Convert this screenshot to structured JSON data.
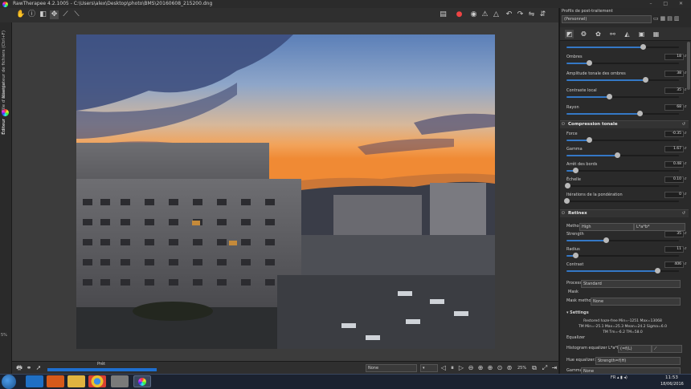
{
  "window": {
    "title": "RawTherapee 4.2.1005 - C:\\Users\\alex\\Desktop\\photo\\BMS\\20160608_215200.dng",
    "controls": [
      "–",
      "□",
      "✕"
    ]
  },
  "icons": {
    "toolbar": [
      "hand-icon",
      "info-icon",
      "crop-select-icon",
      "pan-icon",
      "color-picker-icon",
      "straighten-icon"
    ],
    "toolbar_right": [
      "compare-icon",
      "color-channels-icon",
      "focus-mask-icon",
      "warning-shadow-icon",
      "warning-highlight-icon",
      "rotate-left-icon",
      "rotate-right-icon",
      "flip-horizontal-icon",
      "flip-vertical-icon"
    ]
  },
  "left_tabs": {
    "file_browser": "Navigateur de fichiers (Ctrl+F)",
    "queue": "File d'attente",
    "editor": "Éditeur"
  },
  "zoom_indicator": "5%",
  "bottom": {
    "progress_label": "Prêt",
    "progress_value": 1.0,
    "preview_select": "None",
    "zoom_value": "25%"
  },
  "right_panel": {
    "header": "Profils de post-traitement",
    "profile_value": "(Personnel)",
    "colors": {
      "accent": "#3478c6",
      "panel": "#2a2a2a"
    },
    "sliders_top": [
      {
        "label": "Ombres",
        "value": "18",
        "pos": 0.2
      },
      {
        "label": "Amplitude tonale des ombres",
        "value": "38",
        "pos": 0.7
      },
      {
        "label": "Contraste local",
        "value": "35",
        "pos": 0.38
      },
      {
        "label": "Rayon",
        "value": "68",
        "pos": 0.65
      }
    ],
    "section_tone": {
      "title": "Compression tonale",
      "sliders": [
        {
          "label": "Force",
          "value": "-0.35",
          "pos": 0.2
        },
        {
          "label": "Gamma",
          "value": "1.67",
          "pos": 0.45
        },
        {
          "label": "Arrêt des bords",
          "value": "0.48",
          "pos": 0.08
        },
        {
          "label": "Échelle",
          "value": "0.10",
          "pos": 0.01
        },
        {
          "label": "Itérations de la pondération",
          "value": "0",
          "pos": 0.0
        }
      ]
    },
    "section_retinex": {
      "title": "Retinex",
      "method_label": "Method:",
      "method_value": "High",
      "channel_value": "L*a*b*",
      "sliders": [
        {
          "label": "Strength",
          "value": "35",
          "pos": 0.35
        },
        {
          "label": "Radius",
          "value": "11",
          "pos": 0.08
        },
        {
          "label": "Contrast",
          "value": "406",
          "pos": 0.81
        }
      ],
      "process_label": "Process:",
      "process_value": "Standard",
      "mask_title": "Mask",
      "mask_method_label": "Mask method:",
      "mask_method_value": "None",
      "settings_title": "Settings",
      "stats": [
        "Restored haze-free Min=-1251 Max=13068",
        "TM Min=-25.1 Max=25.3 Mean=24.2 Sigma=6.0",
        "TM Tm=-6.2 TM=58.0"
      ],
      "equalizer_title": "Equalizer",
      "histogram_label": "Histogram equalizer L*a*b*",
      "histogram_value": "(=f(L)",
      "hue_label": "Hue equalizer:",
      "hue_value": "Strength=f(H)",
      "gamma_label": "Gamma:",
      "gamma_value": "None"
    }
  },
  "taskbar": {
    "apps": [
      "ie-icon",
      "media-icon",
      "explorer-icon",
      "chrome-icon",
      "paint-icon",
      "rawtherapee-icon"
    ],
    "lang": "FR",
    "time": "11:53",
    "date": "18/06/2016"
  }
}
